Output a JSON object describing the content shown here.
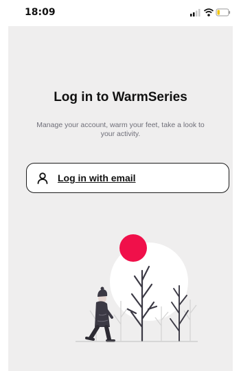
{
  "status_bar": {
    "time": "18:09",
    "icons": [
      "signal-icon",
      "wifi-icon",
      "battery-icon"
    ]
  },
  "login": {
    "title": "Log in to WarmSeries",
    "subtitle": "Manage your account, warm your feet, take a look to your activity.",
    "email_button_label": "Log in with email",
    "email_button_icon": "user-icon"
  },
  "colors": {
    "panel_background": "#efeeee",
    "accent": "#f0104a",
    "text": "#111111",
    "subtitle": "#6e6e78"
  }
}
